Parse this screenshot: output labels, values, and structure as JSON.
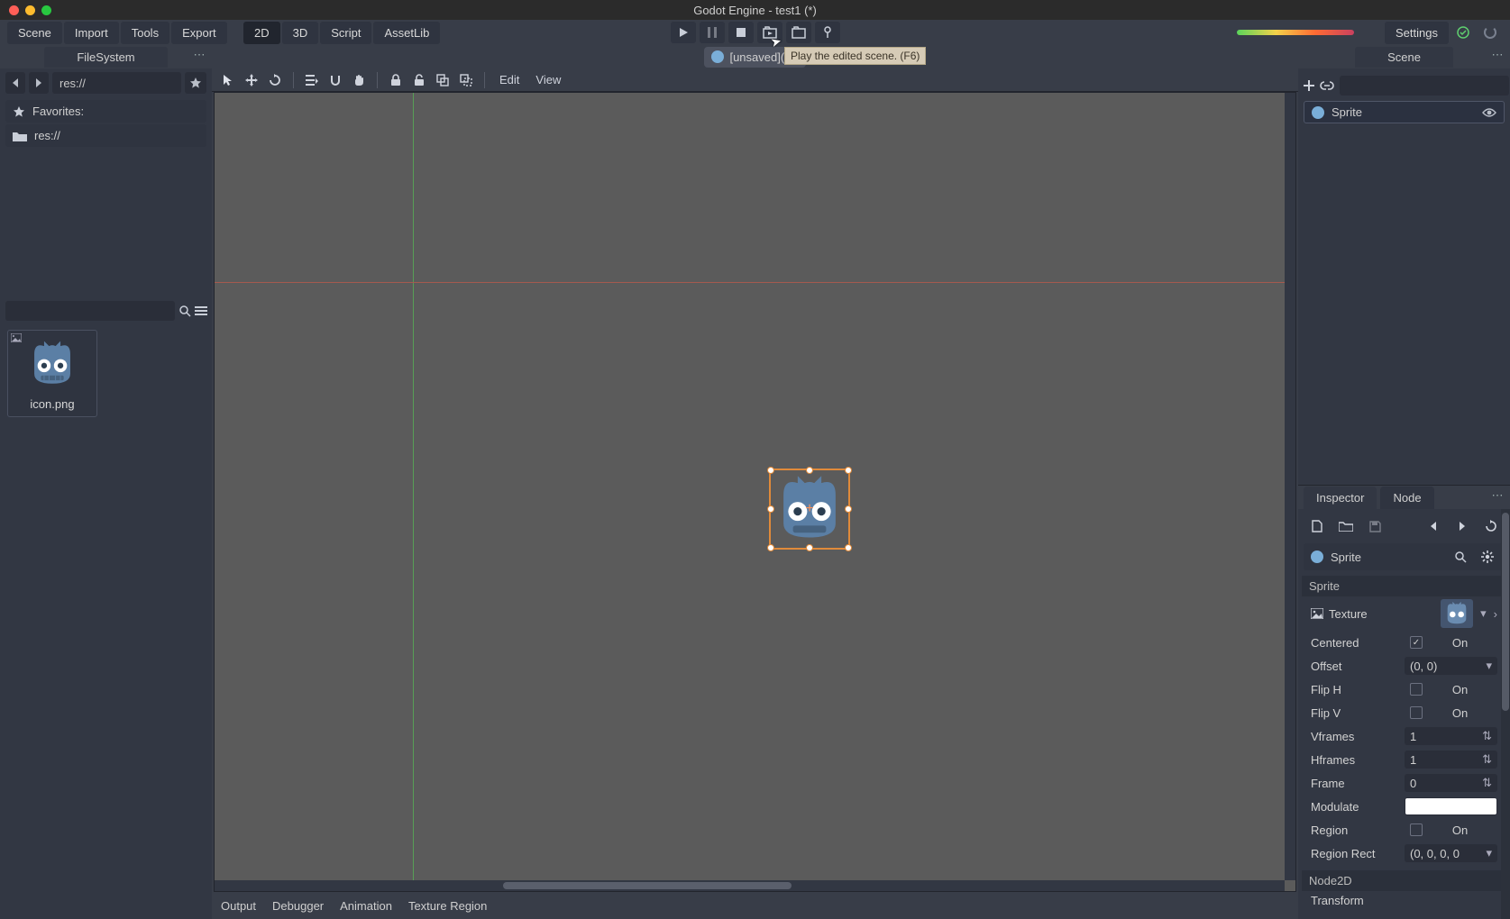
{
  "app": {
    "title": "Godot Engine - test1 (*)"
  },
  "menus": {
    "scene": "Scene",
    "import": "Import",
    "tools": "Tools",
    "export": "Export"
  },
  "workspace": {
    "d2": "2D",
    "d3": "3D",
    "script": "Script",
    "assetlib": "AssetLib",
    "active": "2D"
  },
  "play_tooltip": "Play the edited scene. (F6)",
  "topright": {
    "settings": "Settings"
  },
  "scene_tab": {
    "label": "[unsaved](*)"
  },
  "filesystem": {
    "tab": "FileSystem",
    "path": "res://",
    "favorites_label": "Favorites:",
    "root_label": "res://",
    "thumb_name": "icon.png"
  },
  "viewport_menu": {
    "edit": "Edit",
    "view": "View"
  },
  "bottom": {
    "output": "Output",
    "debugger": "Debugger",
    "animation": "Animation",
    "texregion": "Texture Region"
  },
  "scene_dock": {
    "tab": "Scene",
    "root_node": "Sprite"
  },
  "inspector": {
    "tabs": {
      "inspector": "Inspector",
      "node": "Node"
    },
    "class": "Sprite",
    "section_sprite": "Sprite",
    "section_node2d": "Node2D",
    "transform_label": "Transform",
    "props": {
      "texture": "Texture",
      "centered": "Centered",
      "centered_val": "On",
      "offset": "Offset",
      "offset_val": "(0, 0)",
      "fliph": "Flip H",
      "fliph_val": "On",
      "flipv": "Flip V",
      "flipv_val": "On",
      "vframes": "Vframes",
      "vframes_val": "1",
      "hframes": "Hframes",
      "hframes_val": "1",
      "frame": "Frame",
      "frame_val": "0",
      "modulate": "Modulate",
      "region": "Region",
      "region_val": "On",
      "region_rect": "Region Rect",
      "region_rect_val": "(0, 0, 0, 0"
    }
  }
}
